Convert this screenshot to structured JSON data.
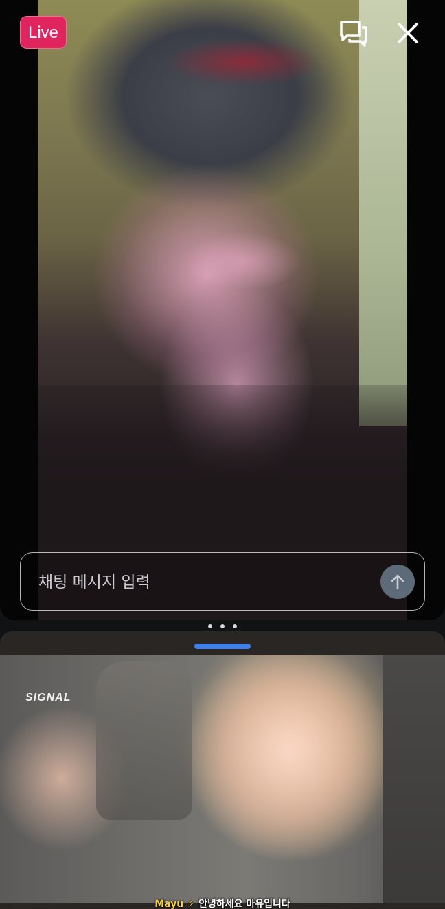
{
  "live": {
    "badge_label": "Live",
    "chat_input_placeholder": "채팅 메시지 입력",
    "icons": {
      "chat": "chat-bubbles-icon",
      "close": "close-icon",
      "send": "arrow-up-icon"
    }
  },
  "pager": {
    "dots": 3
  },
  "preview": {
    "channel_logo": "SIGNAL",
    "subtitle_speaker": "Mayu",
    "subtitle_text": "안녕하세요 마유입니다"
  },
  "colors": {
    "live_badge": "#e0245e",
    "sheet_handle": "#3f7fe6",
    "send_button": "#5d6b78"
  }
}
